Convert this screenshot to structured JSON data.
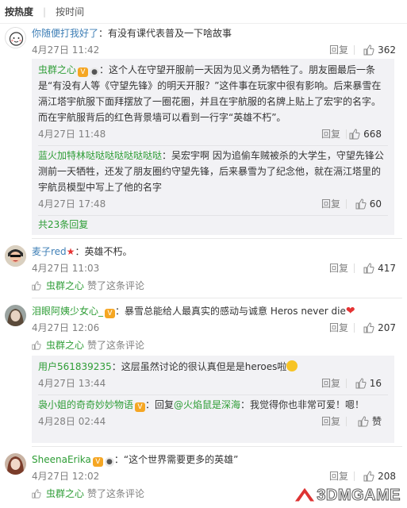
{
  "sort": {
    "hot": "按热度",
    "time": "按时间"
  },
  "comments": [
    {
      "user": "你随便打我好了",
      "text": "：有没有课代表普及一下啥故事",
      "time": "4月27日 11:42",
      "reply": "回复",
      "likes": "362",
      "replies": [
        {
          "user": "虫群之心",
          "text": "：这个人在守望开服前一天因为见义勇为牺牲了。朋友圈最后一条是“有没有人等《守望先锋》的明天开服？”这件事在玩家中很有影响。后来暴雪在滆江塔宇航服下面拜摆放了一圈花圈，并且在宇航服的名牌上贴上了宏宇的名字。而在宇航服背后的红色背景墙可以看到一行字“英雄不朽”。",
          "time": "4月27日 11:48",
          "reply": "回复",
          "likes": "668"
        },
        {
          "user": "蓝火加特林哒哒哒哒哒哒哒哒",
          "text": "：吴宏宇啊 因为追偷车贼被杀的大学生，守望先锋公测前一天牺牲，还发了朋友圈约守望先锋，后来暴雪为了纪念他，就在滆江塔里的宇航员模型中写上了他的名字",
          "time": "4月27日 17:48",
          "reply": "回复",
          "likes": "60"
        }
      ],
      "more": "共23条回复"
    },
    {
      "user": "麦子red",
      "text": "：英雄不朽。",
      "time": "4月27日 11:03",
      "reply": "回复",
      "likes": "417",
      "liked_by": "虫群之心",
      "liked_text": "赞了这条评论"
    },
    {
      "user": "泪眼阿姨少女心_",
      "text": "：暴雪总能给人最真实的感动与诚意 Heros never die",
      "time": "4月27日 12:06",
      "reply": "回复",
      "likes": "207",
      "liked_by": "虫群之心",
      "liked_text": "赞了这条评论",
      "replies": [
        {
          "user": "用户561839235",
          "text": "：这层虽然讨论的很认真但是是heroes啦",
          "time": "4月27日 13:44",
          "reply": "回复",
          "likes": "16"
        },
        {
          "user": "袅小姐的奇奇妙妙物语",
          "text": "：回复",
          "mention": "@火焰鼠是深海",
          "text2": "：我觉得你也非常可爱！嗯！",
          "time": "4月28日 02:44",
          "reply": "回复",
          "likes": "赞"
        }
      ]
    },
    {
      "user": "SheenaErika",
      "text": "：“这个世界需要更多的英雄”",
      "time": "4月27日 12:02",
      "reply": "回复",
      "likes": "208",
      "liked_by": "虫群之心",
      "liked_text": "赞了这条评论"
    }
  ],
  "watermark": "3DMGAME",
  "colors": {
    "username": "#eb7350",
    "sub_username": "#2e9d36",
    "meta": "#808080"
  }
}
